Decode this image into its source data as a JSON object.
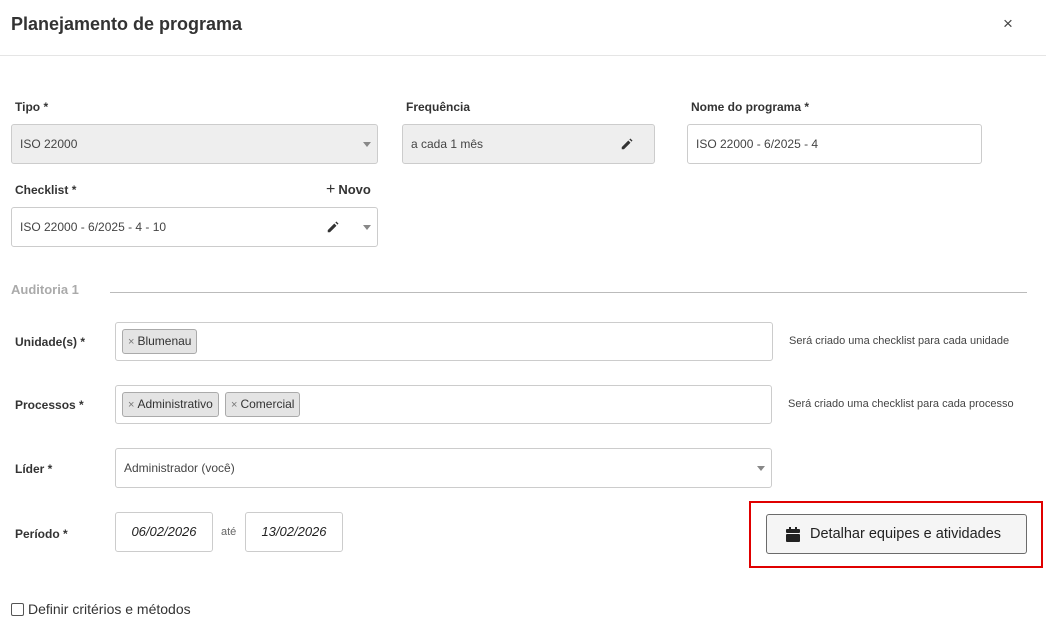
{
  "dialog": {
    "title": "Planejamento de programa",
    "close_label": "×"
  },
  "form": {
    "tipo": {
      "label": "Tipo *",
      "value": "ISO 22000"
    },
    "frequencia": {
      "label": "Frequência",
      "value": "a cada 1 mês"
    },
    "nome": {
      "label": "Nome do programa *",
      "value": "ISO 22000 - 6/2025 - 4"
    },
    "checklist": {
      "label": "Checklist *",
      "value": "ISO 22000 - 6/2025 - 4 - 10",
      "new_label": "Novo"
    }
  },
  "audit": {
    "section_title": "Auditoria 1",
    "unidades": {
      "label": "Unidade(s) *",
      "tags": [
        "Blumenau"
      ],
      "hint": "Será criado uma checklist para cada unidade"
    },
    "processos": {
      "label": "Processos *",
      "tags": [
        "Administrativo",
        "Comercial"
      ],
      "hint": "Será criado uma checklist para cada processo"
    },
    "lider": {
      "label": "Líder *",
      "value": "Administrador (você)"
    },
    "periodo": {
      "label": "Período *",
      "start": "06/02/2026",
      "separator": "até",
      "end": "13/02/2026"
    },
    "detail_button": "Detalhar equipes e atividades"
  },
  "criteria_checkbox": {
    "label": "Definir critérios e métodos",
    "checked": false
  },
  "icons": {
    "close": "close-icon",
    "pencil": "pencil-icon",
    "calendar": "calendar-icon",
    "plus": "plus-icon",
    "caret": "chevron-down-icon"
  },
  "colors": {
    "highlight": "#e00000",
    "disabled_bg": "#eeeeee"
  }
}
